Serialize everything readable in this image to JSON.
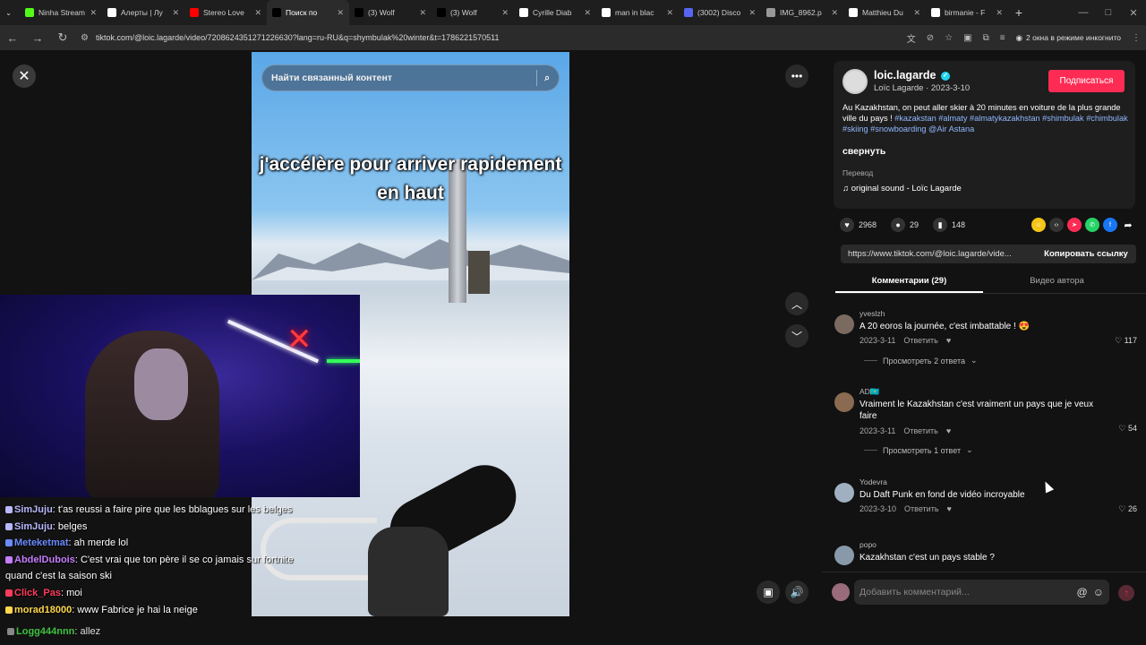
{
  "browser": {
    "tabs": [
      {
        "label": "Ninha Stream",
        "color": "#53fc18",
        "active": false
      },
      {
        "label": "Алерты | Лу",
        "color": "#ffffff",
        "active": false
      },
      {
        "label": "Stereo Love",
        "color": "#ff0000",
        "active": false
      },
      {
        "label": "Поиск по",
        "color": "#000000",
        "active": true
      },
      {
        "label": "(3) Wolf",
        "color": "#000000",
        "active": false
      },
      {
        "label": "(3) Wolf",
        "color": "#000000",
        "active": false
      },
      {
        "label": "Cyrille Diab",
        "color": "#ffffff",
        "active": false
      },
      {
        "label": "man in blac",
        "color": "#ffffff",
        "active": false
      },
      {
        "label": "(3002) Disco",
        "color": "#5865f2",
        "active": false
      },
      {
        "label": "IMG_8962.p",
        "color": "#999999",
        "active": false
      },
      {
        "label": "Matthieu Du",
        "color": "#ffffff",
        "active": false
      },
      {
        "label": "birmanie - F",
        "color": "#ffffff",
        "active": false
      }
    ],
    "new_tab": "+",
    "url": "tiktok.com/@loic.lagarde/video/7208624351271226630?lang=ru-RU&q=shymbulak%20winter&t=1786221570511",
    "incognito_label": "2 окна в режиме инкогнито"
  },
  "video": {
    "search_placeholder": "Найти связанный контент",
    "caption": "j'accélère pour arriver rapidement en haut"
  },
  "chat": [
    {
      "user": "SimJuju",
      "user_color": "#b8b8ff",
      "text": ": t'as reussi a faire pire que les bblagues sur les belges",
      "wrap": false
    },
    {
      "user": "SimJuju",
      "user_color": "#b8b8ff",
      "text": ": belges",
      "wrap": false
    },
    {
      "user": "Meteketmat",
      "user_color": "#6b8cff",
      "text": ": ah merde lol",
      "wrap": false
    },
    {
      "user": "AbdelDubois",
      "user_color": "#c77dff",
      "text": ": C'est vrai que ton père il se co jamais sur fortnite quand c'est la saison ski",
      "wrap": true
    },
    {
      "user": "Click_Pas",
      "user_color": "#ff3b5c",
      "text": ": moi",
      "wrap": false
    },
    {
      "user": "morad18000",
      "user_color": "#ffd84d",
      "text": ": www Fabrice je hai la neige",
      "wrap": false
    }
  ],
  "chat_bottom": {
    "user": "Logg444nnn",
    "text": ": allez",
    "user_color": "#40c040"
  },
  "post": {
    "username": "loic.lagarde",
    "subline": "Loïc Lagarde · 2023-3-10",
    "follow_label": "Подписаться",
    "desc_text": "Au Kazakhstan, on peut aller skier à 20 minutes en voiture de la plus grande ville du pays ! ",
    "desc_tags": "#kazakstan #almaty #almatykazakhstan #shimbulak #chimbulak #skiing #snowboarding @Air Astana",
    "collapse": "свернуть",
    "translate": "Перевод",
    "sound": "original sound - Loïc Lagarde"
  },
  "stats": {
    "likes": "2968",
    "comments": "29",
    "saves": "148"
  },
  "share": {
    "link": "https://www.tiktok.com/@loic.lagarde/vide...",
    "copy_label": "Копировать ссылку"
  },
  "tabs": {
    "comments": "Комментарии (29)",
    "creator_videos": "Видео автора"
  },
  "comments": [
    {
      "user": "yveslzh",
      "text": "A 20 eoros la journée, c'est imbattable ! 😍",
      "date": "2023-3-11",
      "reply": "Ответить",
      "likes": "117",
      "more": "Просмотреть 2 ответа"
    },
    {
      "user": "AD🇰🇿",
      "text": "Vraiment le Kazakhstan c'est vraiment un pays que je veux faire",
      "date": "2023-3-11",
      "reply": "Ответить",
      "likes": "54",
      "more": "Просмотреть 1 ответ"
    },
    {
      "user": "Yodevra",
      "text": "Du Daft Punk en fond de vidéo incroyable",
      "date": "2023-3-10",
      "reply": "Ответить",
      "likes": "26",
      "more": ""
    },
    {
      "user": "popo",
      "text": "Kazakhstan c'est un pays stable ?",
      "date": "",
      "reply": "",
      "likes": "",
      "more": ""
    }
  ],
  "comment_input": {
    "placeholder": "Добавить комментарий..."
  }
}
